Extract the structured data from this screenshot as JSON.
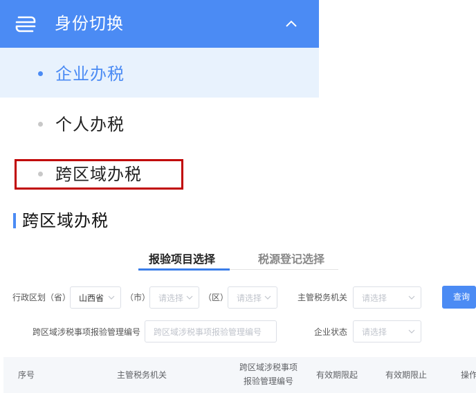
{
  "header": {
    "title": "身份切换",
    "icon": "swap-arrows-icon",
    "collapse_icon": "chevron-up-icon",
    "color": "#4b8bf4"
  },
  "menu": {
    "items": [
      {
        "label": "企业办税",
        "active": true
      },
      {
        "label": "个人办税",
        "active": false
      },
      {
        "label": "跨区域办税",
        "active": false,
        "highlighted": true
      }
    ]
  },
  "section": {
    "title": "跨区域办税"
  },
  "tabs": [
    {
      "label": "报验项目选择",
      "active": true
    },
    {
      "label": "税源登记选择",
      "active": false
    }
  ],
  "filters": {
    "region_label": "行政区划（省）",
    "province_value": "山西省",
    "city_label": "（市）",
    "city_placeholder": "请选择",
    "district_label": "（区）",
    "district_placeholder": "请选择",
    "tax_authority_label": "主管税务机关",
    "tax_authority_placeholder": "请选择",
    "permit_no_label": "跨区域涉税事项报验管理编号",
    "permit_no_placeholder": "跨区域涉税事项报验管理编号",
    "status_label": "企业状态",
    "status_placeholder": "请选择",
    "query_label": "查询"
  },
  "table": {
    "columns": [
      "序号",
      "主管税务机关",
      "跨区域涉税事项",
      "报验管理编号",
      "有效期限起",
      "有效期限止",
      "操作"
    ]
  }
}
